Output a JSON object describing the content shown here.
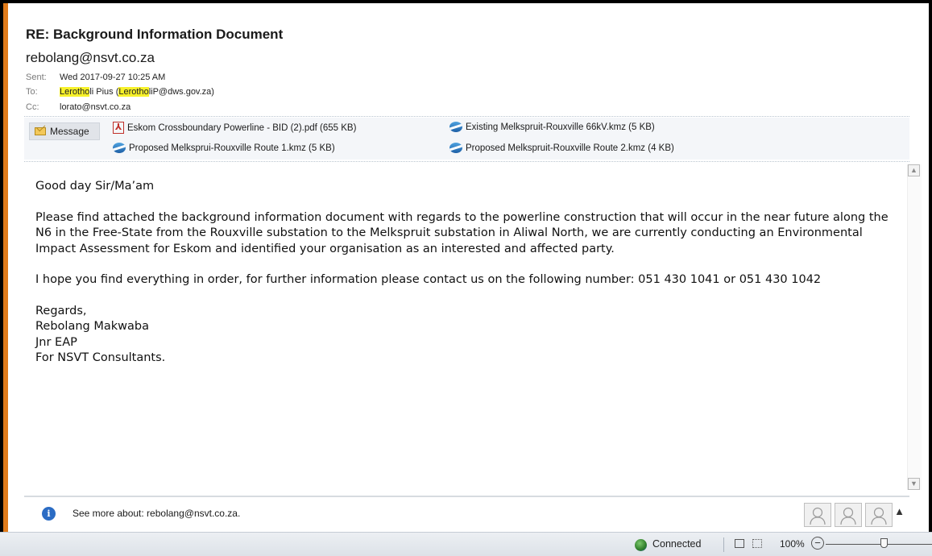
{
  "email": {
    "subject": "RE: Background Information Document",
    "sender": "rebolang@nsvt.co.za",
    "sent_label": "Sent:",
    "sent_value": "Wed 2017-09-27 10:25 AM",
    "to_label": "To:",
    "to_name_hl": "Lerotho",
    "to_name_rest": "li Pius (",
    "to_email_hl": "Lerotho",
    "to_email_rest": "liP@dws.gov.za)",
    "cc_label": "Cc:",
    "cc_value": "lorato@nsvt.co.za"
  },
  "attachments": {
    "message_tab": "Message",
    "items": [
      {
        "name": "Eskom Crossboundary Powerline - BID (2).pdf (655 KB)",
        "icon": "pdf-icon"
      },
      {
        "name": "Existing Melkspruit-Rouxville 66kV.kmz (5 KB)",
        "icon": "globe-icon"
      },
      {
        "name": "Proposed Melksprui-Rouxville Route 1.kmz (5 KB)",
        "icon": "globe-icon"
      },
      {
        "name": "Proposed Melkspruit-Rouxville Route 2.kmz (4 KB)",
        "icon": "globe-icon"
      }
    ]
  },
  "body": {
    "greeting": "Good day Sir/Ma’am",
    "para1": "Please find attached the background information document with regards to the powerline construction that will occur in the near future along the N6 in the Free-State from the Rouxville substation to the Melkspruit substation in Aliwal North, we are currently conducting an Environmental Impact Assessment for Eskom and identified your organisation as an interested and affected party.",
    "para2": "I hope you find everything in order, for further information please contact us on the following number: 051 430 1041 or 051 430 1042",
    "sig1": "Regards,",
    "sig2": "Rebolang Makwaba",
    "sig3": "Jnr EAP",
    "sig4": "For NSVT Consultants."
  },
  "people_pane": {
    "see_more": "See more about: rebolang@nsvt.co.za."
  },
  "status": {
    "connection": "Connected",
    "zoom": "100%",
    "zoom_minus": "−"
  },
  "colors": {
    "highlight": "#f7f12a",
    "accent_stripe": "#e07b1a",
    "info_blue": "#2b6cc4"
  }
}
